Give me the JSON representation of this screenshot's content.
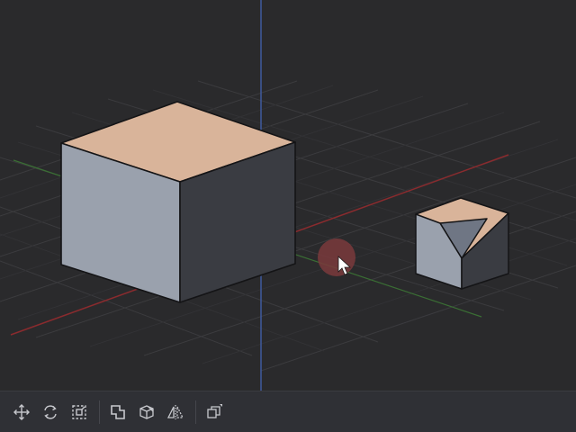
{
  "viewport": {
    "background": "#2a2a2c",
    "axis_colors": {
      "x": "#8a2b2e",
      "y": "#3a6e34",
      "z": "#3f5a9e"
    },
    "objects": [
      {
        "name": "large-cube",
        "top_face_color": "#d9b49a",
        "front_face_color": "#9aa1ad",
        "side_face_color": "#3a3c42"
      },
      {
        "name": "small-beveled-cube",
        "top_face_color": "#d9b49a",
        "front_face_color": "#9aa1ad",
        "side_face_color": "#3a3c42"
      }
    ],
    "cursor_highlight_color": "#7a3a3c"
  },
  "toolbar": {
    "icon_color": "#c8c9ce",
    "tools": [
      {
        "icon": "move-icon"
      },
      {
        "icon": "rotate-icon"
      },
      {
        "icon": "scale-icon"
      },
      {
        "icon": "boolean-union-icon"
      },
      {
        "icon": "bevel-cube-icon"
      },
      {
        "icon": "mirror-icon"
      },
      {
        "icon": "duplicate-icon"
      }
    ]
  }
}
